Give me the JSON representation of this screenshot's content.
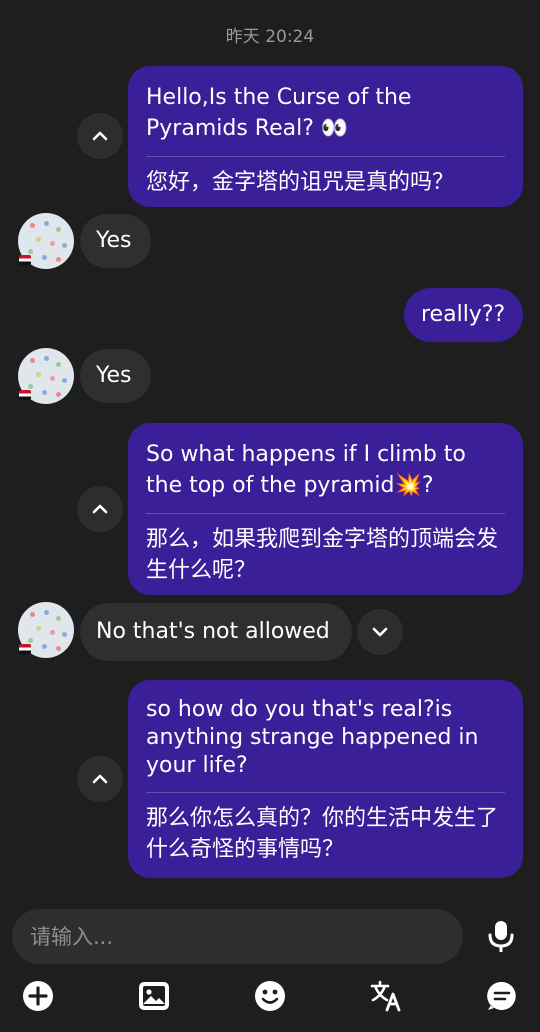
{
  "timestamp": "昨天 20:24",
  "messages": {
    "m1": {
      "en": "Hello,Is the Curse of the Pyramids Real? 👀",
      "zh": "您好，金字塔的诅咒是真的吗？"
    },
    "m2": {
      "text": "Yes"
    },
    "m3": {
      "text": "really??"
    },
    "m4": {
      "text": "Yes"
    },
    "m5": {
      "en": "So what happens if I climb to the top of the pyramid💥?",
      "zh": "那么，如果我爬到金字塔的顶端会发生什么呢？"
    },
    "m6": {
      "text": "No that's not allowed"
    },
    "m7": {
      "en": "so how do you that's real?is anything strange happened in your life?",
      "zh": "那么你怎么真的？你的生活中发生了什么奇怪的事情吗？"
    }
  },
  "input": {
    "placeholder": "请输入..."
  },
  "colors": {
    "outgoing_bubble": "#3a1f98",
    "incoming_bubble": "#2f2f2f",
    "background": "#1e1e1e"
  },
  "icons": [
    "chevron-up-icon",
    "chevron-down-icon",
    "microphone-icon",
    "plus-icon",
    "image-icon",
    "emoji-icon",
    "translate-icon",
    "chat-icon"
  ]
}
